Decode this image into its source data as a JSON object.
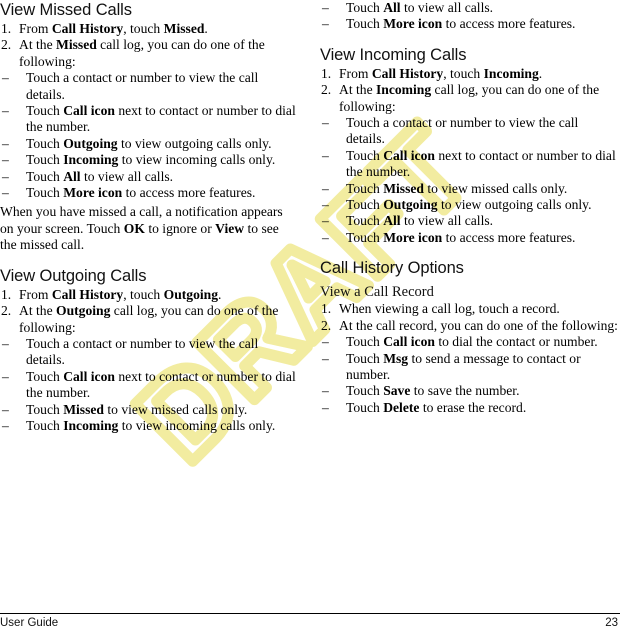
{
  "document": {
    "watermark": "DRAFT",
    "watermark_color": "#f2eca0"
  },
  "footer": {
    "left_label": "User Guide",
    "page_number": "23"
  },
  "left_column": {
    "section1": {
      "heading": "View Missed Calls",
      "steps": [
        {
          "num": "1.",
          "text_parts": [
            {
              "t": "From ",
              "b": false
            },
            {
              "t": "Call History",
              "b": true
            },
            {
              "t": ", touch ",
              "b": false
            },
            {
              "t": "Missed",
              "b": true
            },
            {
              "t": ".",
              "b": false
            }
          ]
        },
        {
          "num": "2.",
          "text_parts": [
            {
              "t": "At the ",
              "b": false
            },
            {
              "t": "Missed",
              "b": true
            },
            {
              "t": " call log, you can do one of the following:",
              "b": false
            }
          ]
        }
      ],
      "bullets": [
        [
          {
            "t": "Touch a contact or number to view the call details.",
            "b": false
          }
        ],
        [
          {
            "t": "Touch ",
            "b": false
          },
          {
            "t": "Call icon",
            "b": true
          },
          {
            "t": " next to contact or number to dial the number.",
            "b": false
          }
        ],
        [
          {
            "t": "Touch ",
            "b": false
          },
          {
            "t": "Outgoing",
            "b": true
          },
          {
            "t": " to view outgoing calls only.",
            "b": false
          }
        ],
        [
          {
            "t": "Touch ",
            "b": false
          },
          {
            "t": "Incoming",
            "b": true
          },
          {
            "t": " to view incoming calls only.",
            "b": false
          }
        ],
        [
          {
            "t": "Touch ",
            "b": false
          },
          {
            "t": "All",
            "b": true
          },
          {
            "t": " to view all calls.",
            "b": false
          }
        ],
        [
          {
            "t": "Touch ",
            "b": false
          },
          {
            "t": "More icon",
            "b": true
          },
          {
            "t": " to access more features.",
            "b": false
          }
        ]
      ],
      "paragraph": [
        {
          "t": "When you have missed a call, a notification appears on your screen. Touch ",
          "b": false
        },
        {
          "t": "OK",
          "b": true
        },
        {
          "t": " to ignore or ",
          "b": false
        },
        {
          "t": "View",
          "b": true
        },
        {
          "t": " to see the missed call.",
          "b": false
        }
      ]
    },
    "section2": {
      "heading": "View Outgoing Calls",
      "steps": [
        {
          "num": "1.",
          "text_parts": [
            {
              "t": "From ",
              "b": false
            },
            {
              "t": "Call History",
              "b": true
            },
            {
              "t": ", touch ",
              "b": false
            },
            {
              "t": "Outgoing",
              "b": true
            },
            {
              "t": ".",
              "b": false
            }
          ]
        },
        {
          "num": "2.",
          "text_parts": [
            {
              "t": "At the ",
              "b": false
            },
            {
              "t": "Outgoing",
              "b": true
            },
            {
              "t": " call log, you can do one of the following:",
              "b": false
            }
          ]
        }
      ],
      "bullets": [
        [
          {
            "t": "Touch a contact or number to view the call details.",
            "b": false
          }
        ],
        [
          {
            "t": "Touch ",
            "b": false
          },
          {
            "t": "Call icon",
            "b": true
          },
          {
            "t": " next to contact or number to dial the number.",
            "b": false
          }
        ],
        [
          {
            "t": "Touch ",
            "b": false
          },
          {
            "t": "Missed",
            "b": true
          },
          {
            "t": " to view missed calls only.",
            "b": false
          }
        ],
        [
          {
            "t": "Touch ",
            "b": false
          },
          {
            "t": "Incoming",
            "b": true
          },
          {
            "t": " to view incoming calls only.",
            "b": false
          }
        ]
      ]
    }
  },
  "right_column": {
    "continued_bullets": [
      [
        {
          "t": "Touch ",
          "b": false
        },
        {
          "t": "All",
          "b": true
        },
        {
          "t": " to view all calls.",
          "b": false
        }
      ],
      [
        {
          "t": "Touch ",
          "b": false
        },
        {
          "t": "More icon",
          "b": true
        },
        {
          "t": " to access more features.",
          "b": false
        }
      ]
    ],
    "section3": {
      "heading": "View Incoming Calls",
      "steps": [
        {
          "num": "1.",
          "text_parts": [
            {
              "t": "From ",
              "b": false
            },
            {
              "t": "Call History",
              "b": true
            },
            {
              "t": ", touch ",
              "b": false
            },
            {
              "t": "Incoming",
              "b": true
            },
            {
              "t": ".",
              "b": false
            }
          ]
        },
        {
          "num": "2.",
          "text_parts": [
            {
              "t": "At the ",
              "b": false
            },
            {
              "t": "Incoming",
              "b": true
            },
            {
              "t": " call log, you can do one of the following:",
              "b": false
            }
          ]
        }
      ],
      "bullets": [
        [
          {
            "t": "Touch a contact or number to view the call details.",
            "b": false
          }
        ],
        [
          {
            "t": "Touch ",
            "b": false
          },
          {
            "t": "Call icon",
            "b": true
          },
          {
            "t": " next to contact or number to dial the number.",
            "b": false
          }
        ],
        [
          {
            "t": "Touch ",
            "b": false
          },
          {
            "t": "Missed",
            "b": true
          },
          {
            "t": " to view missed calls only.",
            "b": false
          }
        ],
        [
          {
            "t": "Touch ",
            "b": false
          },
          {
            "t": "Outgoing",
            "b": true
          },
          {
            "t": " to view outgoing calls only.",
            "b": false
          }
        ],
        [
          {
            "t": "Touch ",
            "b": false
          },
          {
            "t": "All",
            "b": true
          },
          {
            "t": " to view all calls.",
            "b": false
          }
        ],
        [
          {
            "t": "Touch ",
            "b": false
          },
          {
            "t": "More icon",
            "b": true
          },
          {
            "t": " to access more features.",
            "b": false
          }
        ]
      ]
    },
    "section4": {
      "heading": "Call History Options",
      "subheading": "View a Call Record",
      "steps": [
        {
          "num": "1.",
          "text_parts": [
            {
              "t": "When viewing a call log, touch a record.",
              "b": false
            }
          ]
        },
        {
          "num": "2.",
          "text_parts": [
            {
              "t": "At the call record, you can do one of the following:",
              "b": false
            }
          ]
        }
      ],
      "bullets": [
        [
          {
            "t": "Touch ",
            "b": false
          },
          {
            "t": "Call icon",
            "b": true
          },
          {
            "t": " to dial the contact or number.",
            "b": false
          }
        ],
        [
          {
            "t": "Touch ",
            "b": false
          },
          {
            "t": "Msg",
            "b": true
          },
          {
            "t": " to send a message to contact or number.",
            "b": false
          }
        ],
        [
          {
            "t": "Touch ",
            "b": false
          },
          {
            "t": "Save",
            "b": true
          },
          {
            "t": " to save the number.",
            "b": false
          }
        ],
        [
          {
            "t": "Touch ",
            "b": false
          },
          {
            "t": "Delete",
            "b": true
          },
          {
            "t": " to erase the record.",
            "b": false
          }
        ]
      ]
    }
  }
}
